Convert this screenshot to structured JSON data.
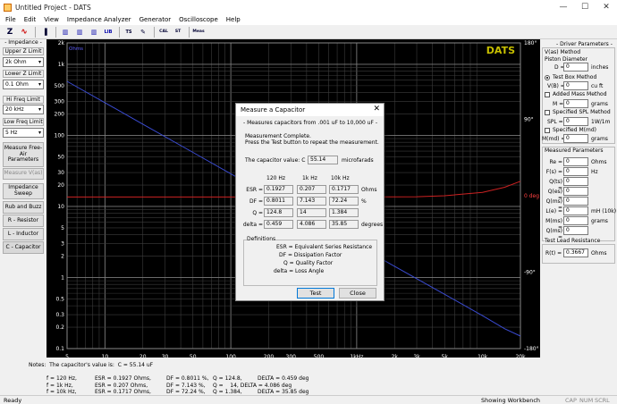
{
  "window": {
    "title": "Untitled Project - DATS",
    "min": "—",
    "max": "☐",
    "close": "✕"
  },
  "menu": [
    "File",
    "Edit",
    "View",
    "Impedance Analyzer",
    "Generator",
    "Oscilloscope",
    "Help"
  ],
  "toolbar": [
    "Z",
    "∿",
    "▐",
    "▥",
    "▥",
    "▥",
    "LIB",
    "TS",
    "✎",
    "CAL",
    "ST",
    "Meas"
  ],
  "left": {
    "impedance_label": "- Impedance -",
    "upper_label": "Upper Z Limit",
    "upper_value": "2k Ohm",
    "lower_label": "Lower Z Limit",
    "lower_value": "0.1 Ohm",
    "hifreq_label": "Hi Freq Limit",
    "hifreq_value": "20 kHz",
    "lofreq_label": "Low Freq Limit",
    "lofreq_value": "5 Hz",
    "btn_measure_free_air": "Measure Free-Air Parameters",
    "btn_measure_vas": "Measure V(as)",
    "btn_impedance_sweep": "Impedance Sweep",
    "btn_rub_buzz": "Rub and Buzz",
    "btn_r": "R - Resistor",
    "btn_l": "L - Inductor",
    "btn_c": "C - Capacitor"
  },
  "chart_data": {
    "type": "line",
    "logo": "DATS",
    "unit_label": "Ohms",
    "x_ticks": [
      "5",
      "10",
      "20",
      "30",
      "50",
      "100",
      "200",
      "300",
      "500",
      "1kHz",
      "2k",
      "3k",
      "5k",
      "10k",
      "20k"
    ],
    "x_values": [
      5,
      10,
      20,
      30,
      50,
      100,
      200,
      300,
      500,
      1000,
      2000,
      3000,
      5000,
      10000,
      20000
    ],
    "y_ticks": [
      "2k",
      "1k",
      "500",
      "300",
      "200",
      "100",
      "50",
      "30",
      "20",
      "10",
      "5",
      "3",
      "2",
      "1",
      "0.5",
      "0.3",
      "0.2",
      "0.1"
    ],
    "y_values": [
      2000,
      1000,
      500,
      300,
      200,
      100,
      50,
      30,
      20,
      10,
      5,
      3,
      2,
      1,
      0.5,
      0.3,
      0.2,
      0.1
    ],
    "phase_ticks": [
      "180°",
      "90°",
      "0 deg",
      "-90°",
      "-180°"
    ],
    "xlim": [
      5,
      20000
    ],
    "ylim": [
      0.1,
      2000
    ],
    "scale": "log-log",
    "series": [
      {
        "color": "#3a4bd1",
        "x": [
          5,
          10,
          20,
          50,
          100,
          200,
          500,
          1000,
          2000,
          5000,
          10000,
          15000,
          20000
        ],
        "y": [
          576,
          288,
          144,
          57.6,
          28.8,
          14.4,
          5.76,
          2.88,
          1.44,
          0.58,
          0.29,
          0.19,
          0.15
        ]
      },
      {
        "color": "#cc2222",
        "x": [
          5,
          100,
          1000,
          3000,
          5000,
          10000,
          15000,
          20000
        ],
        "y": [
          -1.5,
          -1.5,
          -1.5,
          -1.2,
          0,
          4,
          10,
          17
        ]
      }
    ]
  },
  "right": {
    "title": "- Driver Parameters -",
    "vas_method": "V(as) Method",
    "piston": "Piston Diameter",
    "d_label": "D =",
    "d_value": "0",
    "d_unit": "inches",
    "test_box": "Test Box Method",
    "vb_label": "V(B) =",
    "vb_value": "0",
    "vb_unit": "cu ft",
    "added_mass": "Added Mass Method",
    "m_label": "M =",
    "m_value": "0",
    "m_unit": "grams",
    "spl_method": "Specified SPL Method",
    "spl_label": "SPL =",
    "spl_value": "0",
    "spl_unit": "1W/1m",
    "mm_method": "Specified M(md)",
    "mmd_label": "M(md) =",
    "mmd_value": "0",
    "mmd_unit": "grams",
    "measured": "Measured Parameters",
    "params": [
      {
        "label": "Re =",
        "value": "0",
        "unit": "Ohms"
      },
      {
        "label": "F(s) =",
        "value": "0",
        "unit": "Hz"
      },
      {
        "label": "Q(ts) =",
        "value": "0",
        "unit": ""
      },
      {
        "label": "Q(es) =",
        "value": "0",
        "unit": ""
      },
      {
        "label": "Q(ms) =",
        "value": "0",
        "unit": ""
      },
      {
        "label": "L(e) =",
        "value": "0",
        "unit": "mH (10k)"
      },
      {
        "label": "M(ms) =",
        "value": "0",
        "unit": "grams"
      },
      {
        "label": "Q(ms) =",
        "value": "0",
        "unit": ""
      }
    ],
    "lead_title": "Test Lead Resistance",
    "lead_label": "R(t) =",
    "lead_value": "0.3667",
    "lead_unit": "Ohms"
  },
  "notes": {
    "line1": "Notes:  The capacitor's value is:  C = 55.14 uF",
    "rows": [
      [
        "f = 120 Hz,",
        "ESR = 0.1927 Ohms,",
        "DF = 0.8011 %,",
        "Q = 124.8,",
        "DELTA = 0.459 deg"
      ],
      [
        "f = 1k Hz,",
        "ESR = 0.207 Ohms,",
        "DF = 7.143 %,",
        "Q =    14, DELTA = 4.086 deg"
      ],
      [
        "f = 10k Hz,",
        "ESR = 0.1717 Ohms,",
        "DF = 72.24 %,",
        "Q = 1.384,",
        "DELTA = 35.85 deg"
      ]
    ]
  },
  "status": {
    "left": "Ready",
    "mid": "Showing Workbench",
    "cap": "CAP",
    "num": "NUM",
    "scrl": "SCRL"
  },
  "dialog": {
    "title": "Measure a Capacitor",
    "close": "✕",
    "range": "- Measures capacitors from .001 uF to 10,000 uF -",
    "complete1": "Measurement Complete.",
    "complete2": "Press the Test button to repeat the measurement.",
    "cap_label": "The capacitor value:  C =",
    "cap_value": "55.14",
    "cap_unit": "microfarads",
    "headers": [
      "120 Hz",
      "1k Hz",
      "10k Hz"
    ],
    "rows": [
      {
        "label": "ESR =",
        "vals": [
          "0.1927",
          "0.207",
          "0.1717"
        ],
        "unit": "Ohms"
      },
      {
        "label": "DF =",
        "vals": [
          "0.8011",
          "7.143",
          "72.24"
        ],
        "unit": "%"
      },
      {
        "label": "Q =",
        "vals": [
          "124.8",
          "14",
          "1.384"
        ],
        "unit": ""
      },
      {
        "label": "delta =",
        "vals": [
          "0.459",
          "4.086",
          "35.85"
        ],
        "unit": "degrees"
      }
    ],
    "def_title": "Definitions",
    "defs": [
      "ESR = Equivalent Series Resistance",
      "DF = Dissipation Factor",
      "Q = Quality Factor",
      "delta = Loss Angle"
    ],
    "test": "Test",
    "close_btn": "Close"
  }
}
